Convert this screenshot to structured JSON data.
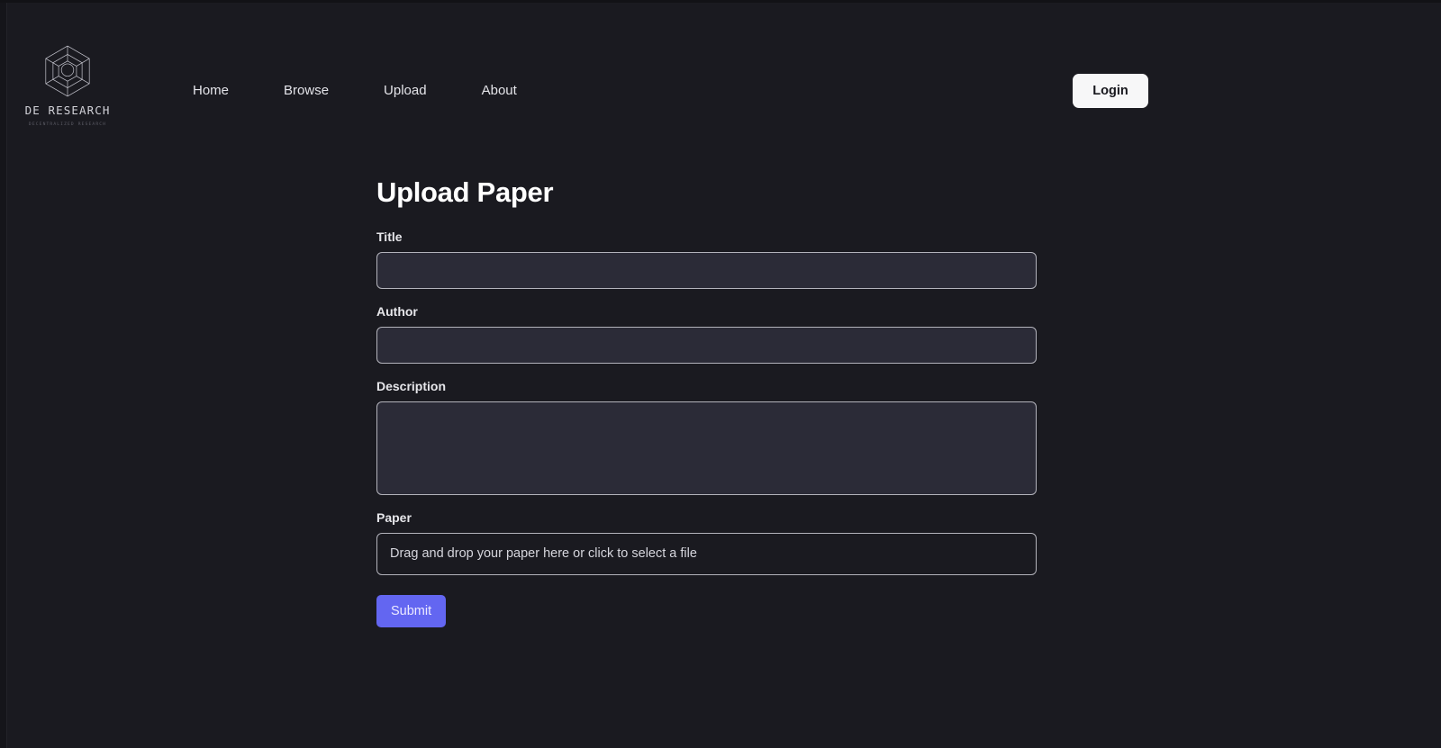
{
  "brand": {
    "name": "DE RESEARCH",
    "tagline": "DECENTRALIZED RESEARCH",
    "logo_icon": "hexagon-cube-wireframe-icon"
  },
  "nav": {
    "items": [
      {
        "label": "Home"
      },
      {
        "label": "Browse"
      },
      {
        "label": "Upload"
      },
      {
        "label": "About"
      }
    ]
  },
  "auth": {
    "login_label": "Login"
  },
  "main": {
    "title": "Upload Paper",
    "fields": {
      "title": {
        "label": "Title",
        "value": "",
        "placeholder": ""
      },
      "author": {
        "label": "Author",
        "value": "",
        "placeholder": ""
      },
      "description": {
        "label": "Description",
        "value": "",
        "placeholder": ""
      },
      "paper": {
        "label": "Paper",
        "dropzone_text": "Drag and drop your paper here or click to select a file"
      }
    },
    "submit_label": "Submit"
  },
  "colors": {
    "page_background": "#1a1a20",
    "input_background": "#2b2b37",
    "input_border": "#b3b3bb",
    "accent_submit": "#6366f1",
    "login_background": "#f7f7f8",
    "login_text": "#17171d",
    "text_primary": "#ffffff",
    "text_secondary": "#d6d6dd"
  }
}
